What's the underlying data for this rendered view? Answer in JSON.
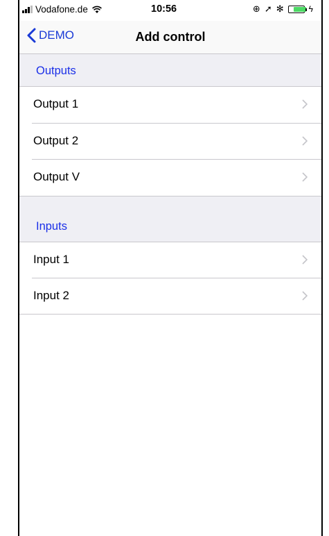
{
  "status_bar": {
    "carrier": "Vodafone.de",
    "time": "10:56",
    "icons": [
      "signal-icon",
      "wifi-icon",
      "orientation-lock-icon",
      "location-icon",
      "bluetooth-icon",
      "battery-icon"
    ],
    "battery_color": "#4cd964"
  },
  "nav": {
    "back_label": "DEMO",
    "title": "Add control",
    "accent": "#1a3ad6"
  },
  "sections": [
    {
      "header": "Outputs",
      "rows": [
        {
          "label": "Output 1"
        },
        {
          "label": "Output 2"
        },
        {
          "label": "Output V"
        }
      ]
    },
    {
      "header": "Inputs",
      "rows": [
        {
          "label": "Input 1"
        },
        {
          "label": "Input 2"
        }
      ]
    }
  ],
  "colors": {
    "section_header_text": "#1a2fe8",
    "grouped_background": "#efeff4",
    "separator": "#c8c7cc"
  }
}
